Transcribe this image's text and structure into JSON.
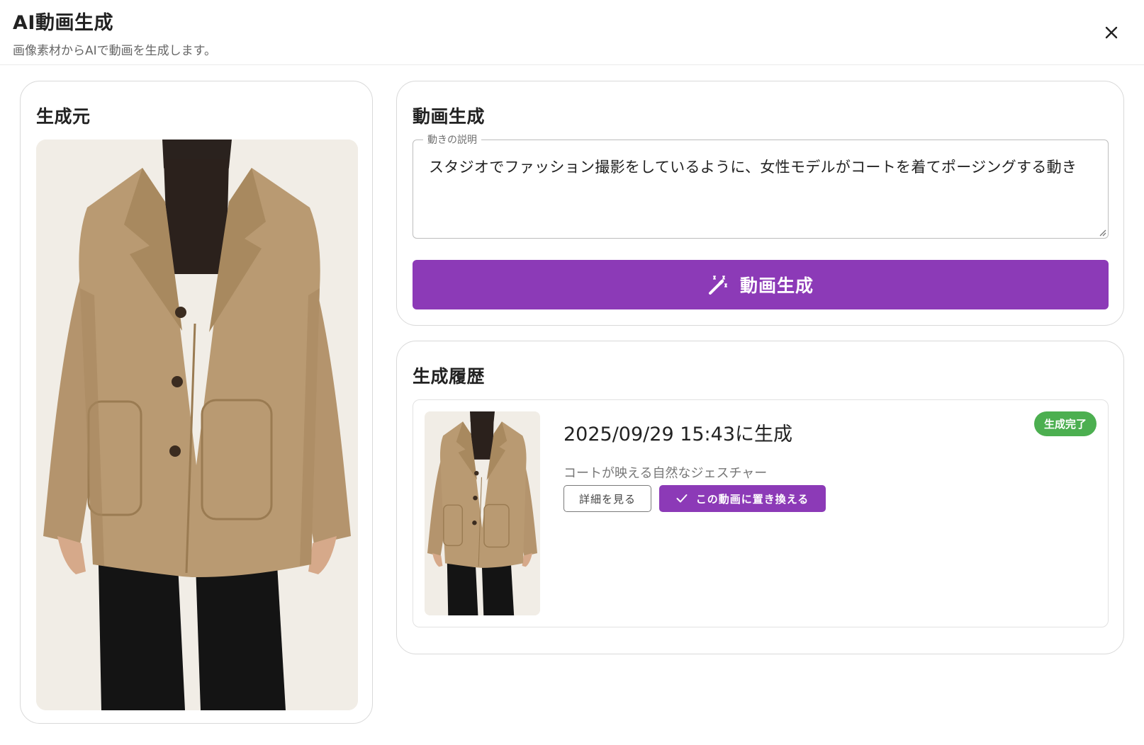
{
  "header": {
    "title": "AI動画生成",
    "subtitle": "画像素材からAIで動画を生成します。",
    "close_icon": "close-icon"
  },
  "source": {
    "title": "生成元",
    "image_icon": "coat-photo"
  },
  "generate": {
    "title": "動画生成",
    "field_label": "動きの説明",
    "field_value": "スタジオでファッション撮影をしているように、女性モデルがコートを着てポージングする動き",
    "button_label": "動画生成",
    "button_icon": "magic-wand-icon",
    "accent_color": "#8c3ab7"
  },
  "history": {
    "title": "生成履歴",
    "items": [
      {
        "date": "2025/09/29 15:43に生成",
        "description": "コートが映える自然なジェスチャー",
        "status": "生成完了",
        "status_color": "#4caf50",
        "detail_label": "詳細を見る",
        "replace_label": "この動画に置き換える",
        "replace_icon": "check-icon"
      }
    ]
  }
}
